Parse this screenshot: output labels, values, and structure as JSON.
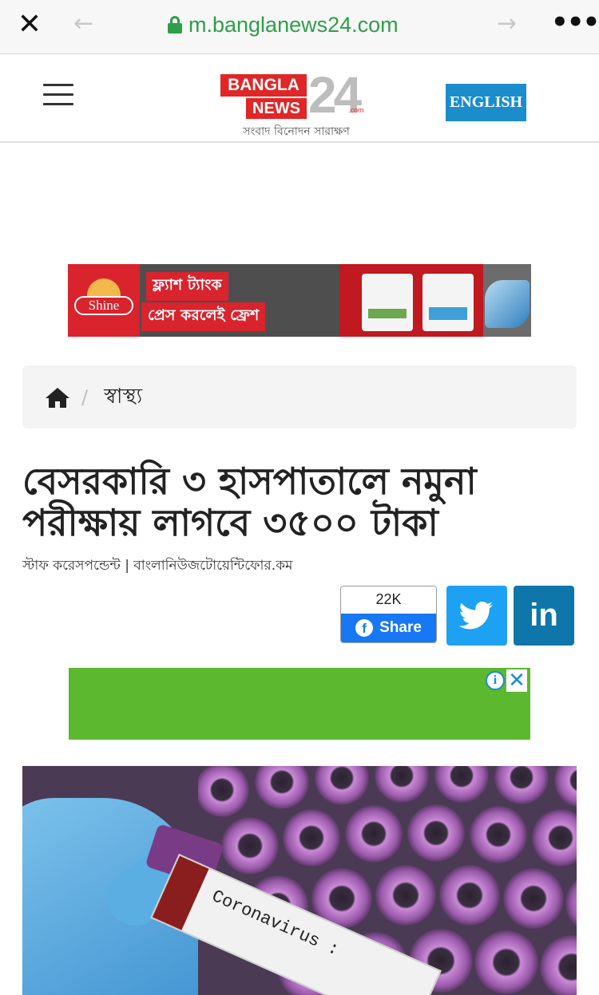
{
  "browser": {
    "url": "m.banglanews24.com",
    "close_glyph": "✕",
    "back_glyph": "←",
    "forward_glyph": "→",
    "more_glyph": "•••"
  },
  "header": {
    "logo_line1": "BANGLA",
    "logo_line2": "NEWS",
    "logo_number": "24",
    "logo_com": ".com",
    "logo_tagline": "সংবাদ বিনোদন সারাক্ষণ",
    "language_button": "ENGLISH"
  },
  "top_ad": {
    "brand": "Shine",
    "line1": "ফ্ল্যাশ ট্যাংক",
    "line2": "প্রেস করলেই ফ্রেশ"
  },
  "breadcrumb": {
    "separator": "/",
    "category": "স্বাস্থ্য"
  },
  "article": {
    "headline": "বেসরকারি ৩ হাসপাতালে নমুনা পরীক্ষায় লাগবে ৩৫০০ টাকা",
    "byline": "স্টাফ করেসপন্ডেন্ট | বাংলানিউজটোয়েন্টিফোর.কম",
    "image_label": "Coronavirus :"
  },
  "share": {
    "facebook_count": "22K",
    "facebook_label": "Share",
    "facebook_icon": "f",
    "linkedin_label": "in"
  },
  "green_ad": {
    "info_glyph": "i",
    "close_glyph": "✕"
  },
  "colors": {
    "brand_red": "#e02626",
    "english_blue": "#1b8ccc",
    "url_green": "#2e9e4a",
    "facebook": "#1877f2",
    "twitter": "#1da1f2",
    "linkedin": "#0e76a8",
    "ad_green": "#5cb82f"
  }
}
